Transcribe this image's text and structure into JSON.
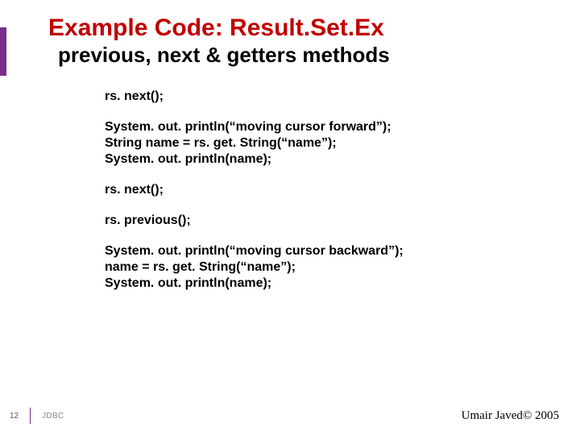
{
  "colors": {
    "accent": "#7A2E8C",
    "title": "#C00000"
  },
  "title": "Example Code: Result.Set.Ex",
  "subtitle": "previous, next & getters methods",
  "code": {
    "p1": "rs. next();",
    "p2a": "System. out. println(“moving cursor forward”);",
    "p2b": "String name = rs. get. String(“name”);",
    "p2c": "System. out. println(name);",
    "p3": "rs. next();",
    "p4": "rs. previous();",
    "p5a": "System. out. println(“moving cursor backward”);",
    "p5b": "name = rs. get. String(“name”);",
    "p5c": "System. out. println(name);"
  },
  "footer": {
    "page": "12",
    "section": "JDBC",
    "credit": "Umair Javed© 2005"
  }
}
